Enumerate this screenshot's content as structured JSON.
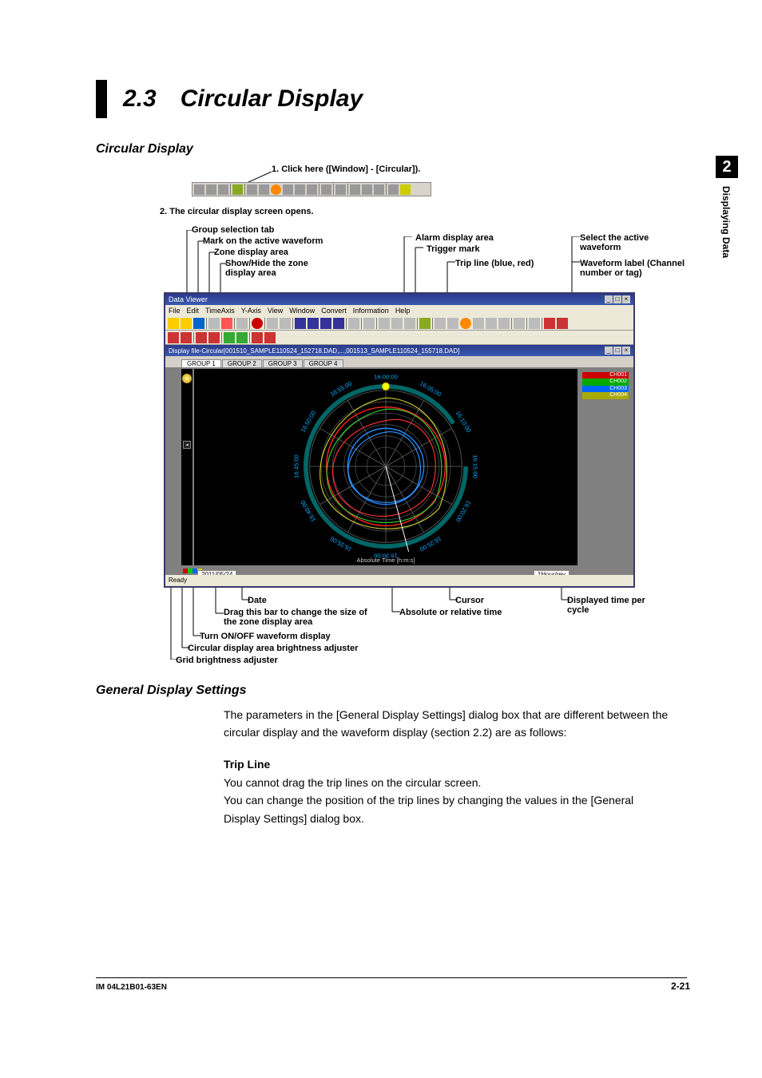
{
  "sidebar": {
    "chapter_num": "2",
    "chapter_label": "Displaying Data"
  },
  "section": {
    "number": "2.3",
    "title": "Circular Display"
  },
  "subsection": "Circular Display",
  "figure": {
    "step1": "1. Click here ([Window] - [Circular]).",
    "step2": "2. The circular display screen opens.",
    "callouts_left": [
      "Group selection tab",
      "Mark on the active waveform",
      "Zone display area",
      "Show/Hide the zone display area"
    ],
    "callouts_mid": [
      "Alarm display area",
      "Trigger mark",
      "Trip line (blue, red)"
    ],
    "callouts_right": [
      "Select the active waveform",
      "Waveform label (Channel number or tag)"
    ],
    "callouts_bottom": {
      "date": "Date",
      "drag": "Drag this bar to change the size of the zone display area",
      "turnon": "Turn ON/OFF waveform display",
      "circ_bright": "Circular display area brightness adjuster",
      "grid_bright": "Grid brightness adjuster",
      "cursor": "Cursor",
      "abs_rel": "Absolute or relative time",
      "disp_time": "Displayed time per cycle"
    }
  },
  "app": {
    "title": "Data Viewer",
    "menu": [
      "File",
      "Edit",
      "TimeAxis",
      "Y-Axis",
      "View",
      "Window",
      "Convert",
      "Information",
      "Help"
    ],
    "doc_title": "Display file-Circular[001510_SAMPLE110524_152718.DAD,...,001513_SAMPLE110524_155718.DAD]",
    "tabs": [
      "GROUP 1",
      "GROUP 2",
      "GROUP 3",
      "GROUP 4"
    ],
    "date_box": "2011/05/24",
    "xaxis_label": "Absolute Time [h:m:s]",
    "cycle_box": "1Hour/rev",
    "ready": "Ready",
    "legend": [
      "CH001",
      "CH002",
      "CH003",
      "CH004"
    ],
    "times": [
      "16:00:00",
      "16:05:00",
      "16:10:00",
      "16:15:00",
      "16:20:00",
      "16:25:00",
      "16:30:00",
      "16:35:00",
      "16:40:00",
      "16:45:00",
      "16:50:00",
      "16:55:00"
    ]
  },
  "general": {
    "heading": "General Display Settings",
    "para": "The parameters in the [General Display Settings] dialog box that are different between the circular display and the waveform display (section 2.2) are as follows:",
    "trip_h": "Trip Line",
    "trip_p1": "You cannot drag the trip lines on the circular screen.",
    "trip_p2": "You can change the position of the trip lines by changing the values in the [General Display Settings] dialog box."
  },
  "footer": {
    "doc_id": "IM 04L21B01-63EN",
    "page": "2-21"
  }
}
